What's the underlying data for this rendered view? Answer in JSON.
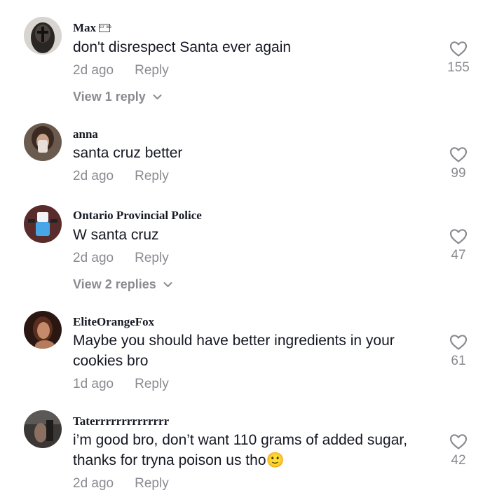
{
  "comments": [
    {
      "username": "Max",
      "badge": "GIF RED",
      "text": "don't disrespect Santa ever again",
      "time": "2d ago",
      "reply_label": "Reply",
      "likes": "155",
      "view_replies": "View 1 reply"
    },
    {
      "username": "anna",
      "text": "santa cruz better",
      "time": "2d ago",
      "reply_label": "Reply",
      "likes": "99"
    },
    {
      "username": "Ontario Provincial Police",
      "text": "W santa cruz",
      "time": "2d ago",
      "reply_label": "Reply",
      "likes": "47",
      "view_replies": "View 2 replies"
    },
    {
      "username": "EliteOrangeFox",
      "text": "Maybe you should have better ingredients in your cookies bro",
      "time": "1d ago",
      "reply_label": "Reply",
      "likes": "61"
    },
    {
      "username": "Taterrrrrrrrrrrrrr",
      "text": "i’m good bro, don’t want 110 grams of added sugar, thanks for tryna poison us tho🙂",
      "time": "2d ago",
      "reply_label": "Reply",
      "likes": "42"
    }
  ],
  "colors": {
    "primary_text": "#161823",
    "secondary_text": "#8a8b91"
  },
  "icons": [
    "heart-icon",
    "chevron-down-icon"
  ]
}
